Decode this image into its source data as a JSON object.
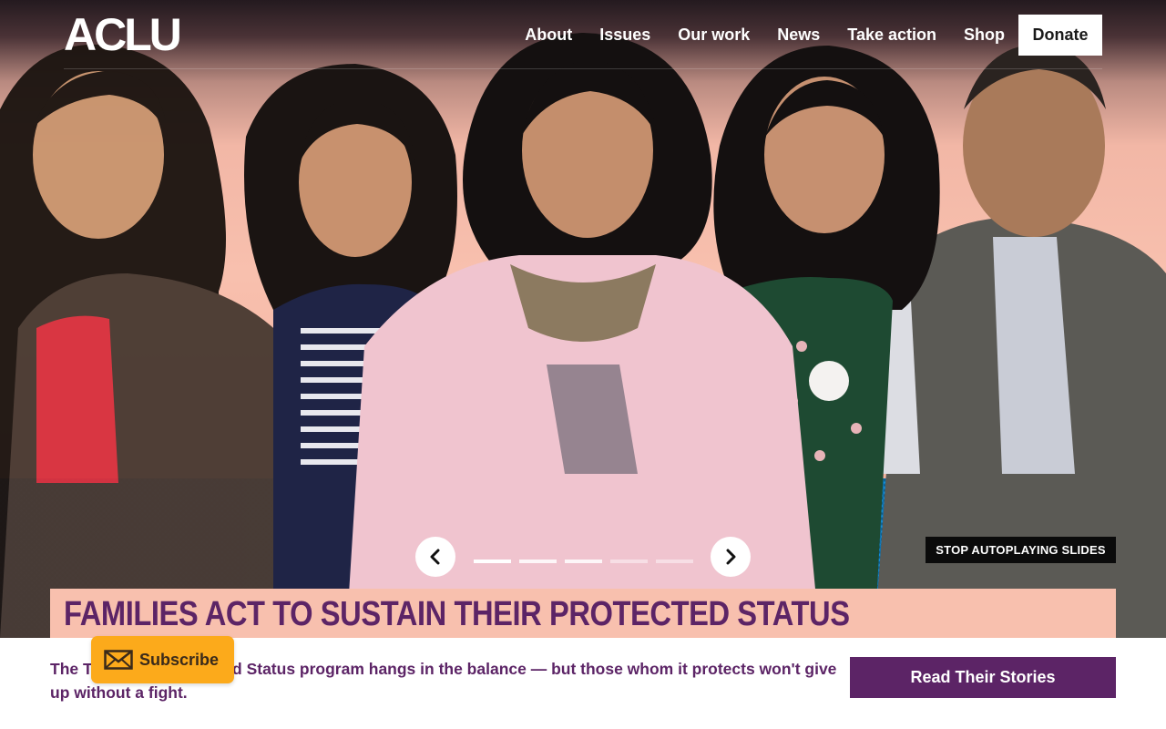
{
  "brand": {
    "logo_text": "ACLU"
  },
  "nav": {
    "items": [
      {
        "label": "About"
      },
      {
        "label": "Issues"
      },
      {
        "label": "Our work"
      },
      {
        "label": "News"
      },
      {
        "label": "Take action"
      },
      {
        "label": "Shop"
      }
    ],
    "donate_label": "Donate"
  },
  "hero": {
    "image_description_icon": "portrait-photo-five-people",
    "carousel": {
      "prev_icon": "chevron-left-icon",
      "next_icon": "chevron-right-icon",
      "slide_count": 5,
      "active_index": 0,
      "stop_label": "STOP AUTOPLAYING SLIDES"
    },
    "headline": "FAMILIES ACT TO SUSTAIN THEIR PROTECTED STATUS",
    "description": "The Temporary Protected Status program hangs in the balance — but those whom it protects won't give up without a fight.",
    "cta_label": "Read Their Stories"
  },
  "subscribe": {
    "label": "Subscribe",
    "icon": "envelope-icon"
  },
  "colors": {
    "brand_purple": "#5c2466",
    "headline_band": "#f8c0ae",
    "subscribe_orange": "#fcaa1b",
    "hero_blue": "#1ba6e4"
  }
}
